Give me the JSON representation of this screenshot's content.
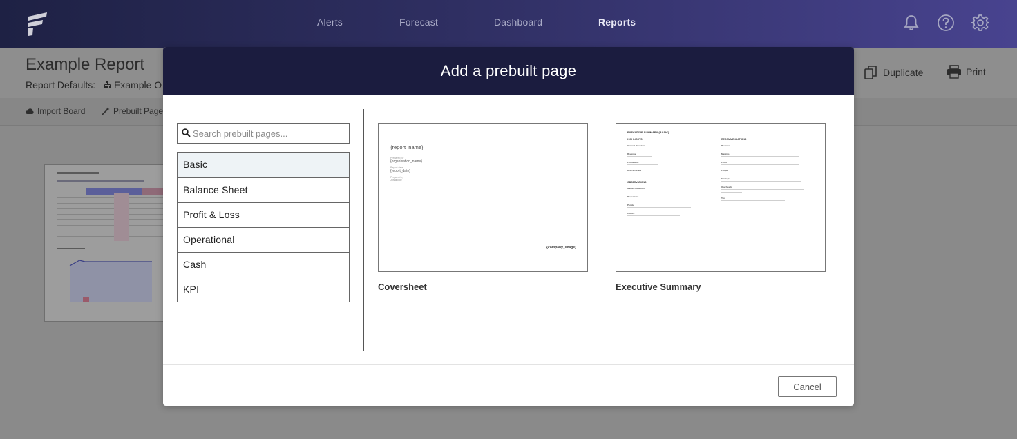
{
  "nav": {
    "items": [
      {
        "label": "Alerts",
        "active": false
      },
      {
        "label": "Forecast",
        "active": false
      },
      {
        "label": "Dashboard",
        "active": false
      },
      {
        "label": "Reports",
        "active": true
      }
    ],
    "icons": [
      "bell-icon",
      "help-icon",
      "gear-icon"
    ]
  },
  "page": {
    "title": "Example Report",
    "defaults_label": "Report Defaults:",
    "defaults_org": "Example O",
    "actions": {
      "duplicate": "Duplicate",
      "print": "Print"
    },
    "toolbar": {
      "import_board": "Import Board",
      "prebuilt_pages": "Prebuilt Page"
    }
  },
  "modal": {
    "title": "Add a prebuilt page",
    "search": {
      "placeholder": "Search prebuilt pages...",
      "value": ""
    },
    "categories": [
      {
        "label": "Basic",
        "selected": true
      },
      {
        "label": "Balance Sheet",
        "selected": false
      },
      {
        "label": "Profit & Loss",
        "selected": false
      },
      {
        "label": "Operational",
        "selected": false
      },
      {
        "label": "Cash",
        "selected": false
      },
      {
        "label": "KPI",
        "selected": false
      }
    ],
    "pages": [
      {
        "label": "Coversheet",
        "preview": {
          "report_name": "{report_name}",
          "org_caption": "Prepared for",
          "org_name": "{organisation_name}",
          "date_caption": "Report date",
          "report_date": "{report_date}",
          "by_caption": "Prepared by",
          "by_value": "Jonas cole",
          "company_image": "{company_image}"
        }
      },
      {
        "label": "Executive Summary",
        "preview": {
          "title": "EXECUTIVE SUMMARY (BASIC)",
          "left_heading": "HIGHLIGHTS",
          "right_heading": "RECOMMENDATIONS",
          "observations_heading": "OBSERVATIONS",
          "left_items": [
            "General Overview",
            "Revenue",
            "Profitability",
            "Debt & Assets"
          ],
          "obs_items": [
            "Market Conditions",
            "Projections",
            "People",
            "CAPEX"
          ],
          "right_items": [
            "Revenue",
            "Margins",
            "Profit",
            "People",
            "Strategic",
            "Overheads",
            "Tax"
          ]
        }
      }
    ],
    "cancel_label": "Cancel"
  },
  "colors": {
    "nav_start": "#1e2144",
    "nav_end": "#48438f",
    "modal_header": "#1b1c3f",
    "selected_row": "#eef3f6"
  }
}
